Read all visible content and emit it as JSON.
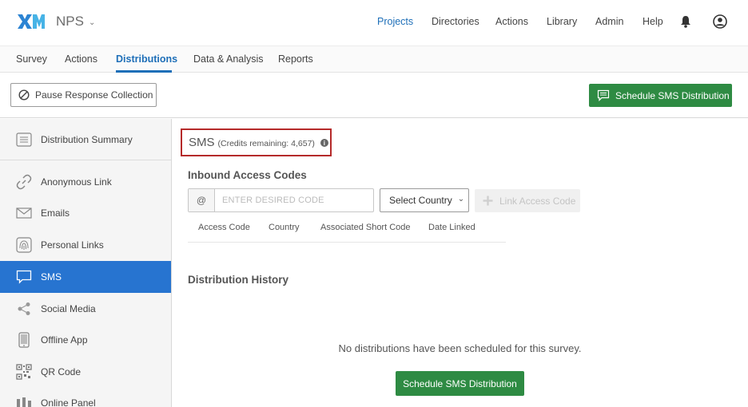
{
  "brand": {
    "logo_text": "XM",
    "project_name": "NPS",
    "accent": "#1e6fb8",
    "green": "#2e8b43",
    "active_blue": "#2774d0"
  },
  "topnav": {
    "items": [
      {
        "label": "Projects",
        "active": true
      },
      {
        "label": "Directories"
      },
      {
        "label": "Actions"
      },
      {
        "label": "Library"
      },
      {
        "label": "Admin"
      },
      {
        "label": "Help"
      }
    ],
    "bell_icon": "bell-icon",
    "user_icon": "user-icon"
  },
  "subtabs": [
    {
      "label": "Survey"
    },
    {
      "label": "Actions"
    },
    {
      "label": "Distributions",
      "active": true
    },
    {
      "label": "Data & Analysis"
    },
    {
      "label": "Reports"
    }
  ],
  "actionbar": {
    "pause_label": "Pause Response Collection",
    "schedule_label": "Schedule SMS Distribution"
  },
  "sidebar": {
    "items": [
      {
        "label": "Distribution Summary",
        "icon": "summary-icon"
      },
      {
        "label": "Anonymous Link",
        "icon": "link-icon"
      },
      {
        "label": "Emails",
        "icon": "envelope-icon"
      },
      {
        "label": "Personal Links",
        "icon": "fingerprint-icon"
      },
      {
        "label": "SMS",
        "icon": "chat-bubble-icon",
        "active": true
      },
      {
        "label": "Social Media",
        "icon": "share-icon"
      },
      {
        "label": "Offline App",
        "icon": "tablet-icon"
      },
      {
        "label": "QR Code",
        "icon": "qr-code-icon"
      },
      {
        "label": "Online Panel",
        "icon": "panel-icon"
      }
    ]
  },
  "main": {
    "sms_title": "SMS",
    "credits_text": "(Credits remaining: 4,657)",
    "info_glyph": "i",
    "inbound_title": "Inbound Access Codes",
    "at_symbol": "@",
    "code_placeholder": "ENTER DESIRED CODE",
    "code_value": "",
    "select_country_label": "Select Country",
    "link_code_label": "Link Access Code",
    "columns": [
      "Access Code",
      "Country",
      "Associated Short Code",
      "Date Linked"
    ],
    "history_title": "Distribution History",
    "empty_message": "No distributions have been scheduled for this survey.",
    "schedule_label": "Schedule SMS Distribution"
  }
}
